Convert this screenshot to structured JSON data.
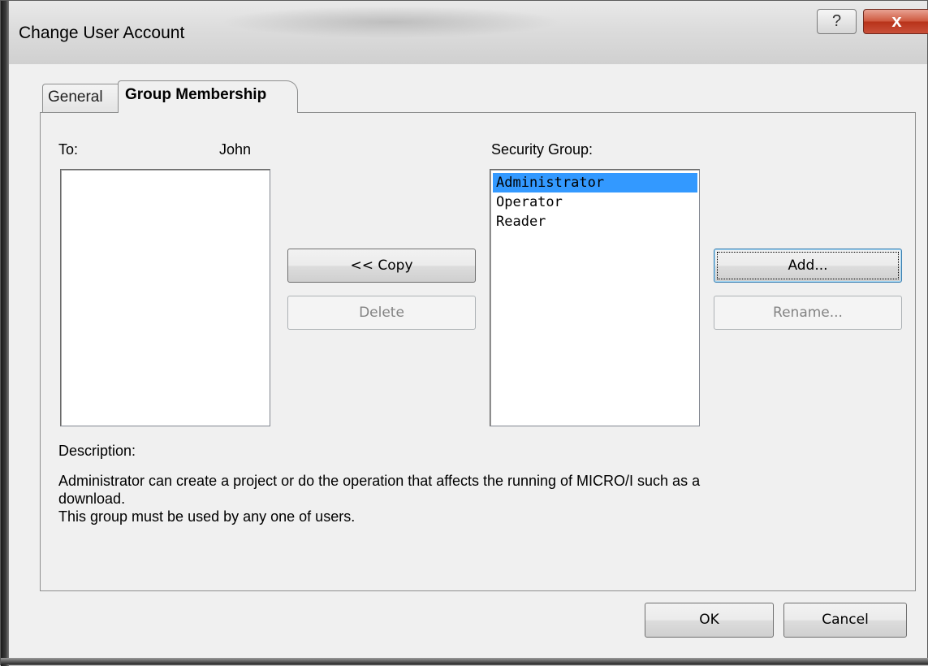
{
  "window": {
    "title": "Change User Account",
    "help_glyph": "?",
    "close_glyph": "x"
  },
  "tabs": [
    {
      "label": "General"
    },
    {
      "label": "Group Membership"
    }
  ],
  "to": {
    "label": "To:",
    "user": "John",
    "items": []
  },
  "security_group": {
    "label": "Security Group:",
    "items": [
      "Administrator",
      "Operator",
      "Reader"
    ],
    "selected": "Administrator"
  },
  "buttons": {
    "copy": "<< Copy",
    "delete": "Delete",
    "add": "Add...",
    "rename": "Rename...",
    "ok": "OK",
    "cancel": "Cancel"
  },
  "description": {
    "label": "Description:",
    "line1": "Administrator can create a project or do the operation that affects the running of MICRO/I such as a",
    "line2": "download.",
    "line3": "This group must be used by any one of users."
  },
  "colors": {
    "selection": "#3399ff",
    "close_button": "#c9503a"
  }
}
